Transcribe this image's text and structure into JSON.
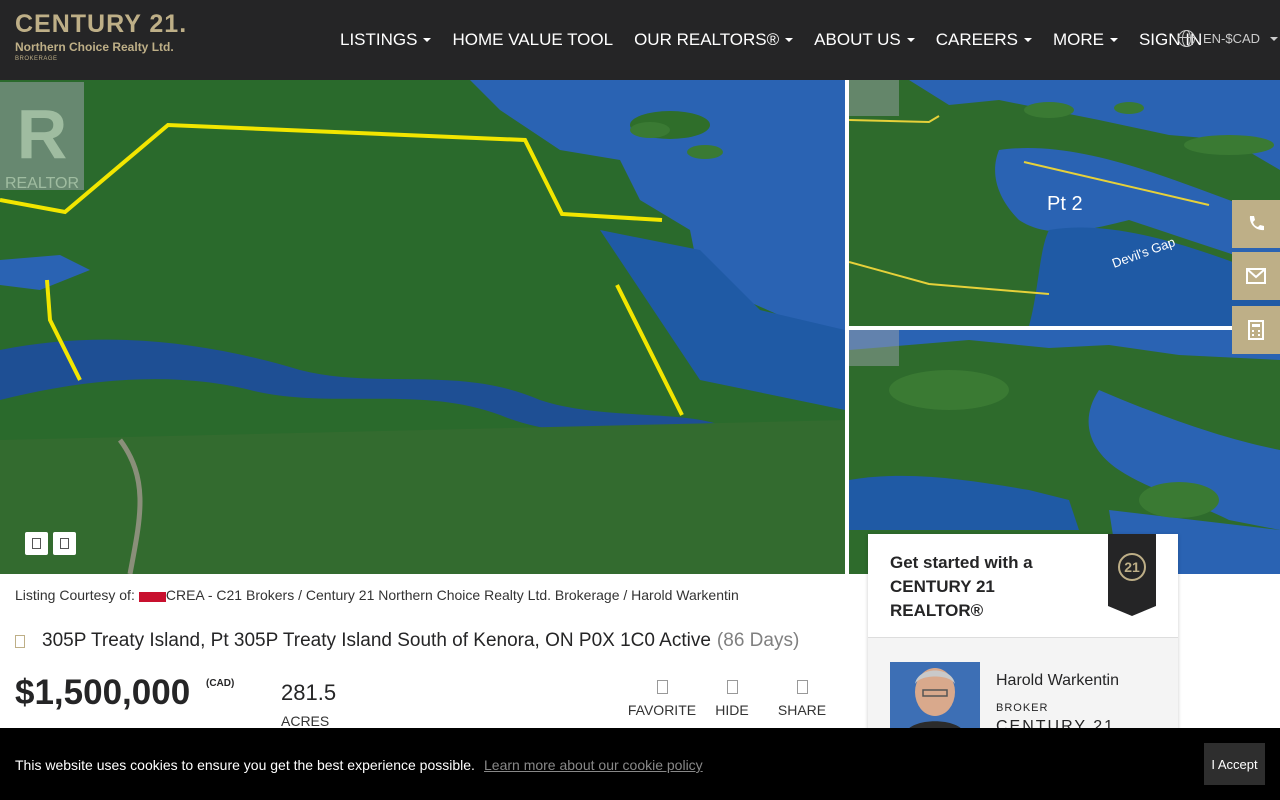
{
  "header": {
    "logo_main": "CENTURY 21.",
    "logo_sub": "Northern Choice Realty Ltd.",
    "logo_brokerage": "BROKERAGE",
    "nav": [
      {
        "label": "LISTINGS",
        "dropdown": true
      },
      {
        "label": "HOME VALUE TOOL",
        "dropdown": false
      },
      {
        "label": "OUR REALTORS®",
        "dropdown": true
      },
      {
        "label": "ABOUT US",
        "dropdown": true
      },
      {
        "label": "CAREERS",
        "dropdown": true
      },
      {
        "label": "MORE",
        "dropdown": true
      },
      {
        "label": "SIGN IN",
        "dropdown": false
      }
    ],
    "language": "EN-$CAD"
  },
  "photos": {
    "side1_label": "Pt 2",
    "side1_caption": "Devil's Gap",
    "watermark": "REALTOR"
  },
  "listing": {
    "courtesy_label": "Listing Courtesy of:",
    "courtesy_text": "CREA - C21 Brokers / Century 21 Northern Choice Realty Ltd. Brokerage / Harold Warkentin",
    "address": "305P Treaty Island, Pt 305P Treaty Island South of Kenora, ON P0X 1C0 Active",
    "days": "(86 Days)",
    "price": "$1,500,000",
    "currency": "(CAD)",
    "acres_value": "281.5",
    "acres_label": "ACRES",
    "actions": {
      "favorite": "FAVORITE",
      "hide": "HIDE",
      "share": "SHARE"
    }
  },
  "agent_card": {
    "title": "Get started with a CENTURY 21 REALTOR®",
    "badge": "21",
    "name": "Harold Warkentin",
    "role": "BROKER",
    "company": "CENTURY 21"
  },
  "cookie": {
    "text": "This website uses cookies to ensure you get the best experience possible.",
    "link": "Learn more about our cookie policy",
    "button": "I Accept"
  },
  "colors": {
    "brand_dark": "#252526",
    "brand_gold": "#beaf87"
  }
}
